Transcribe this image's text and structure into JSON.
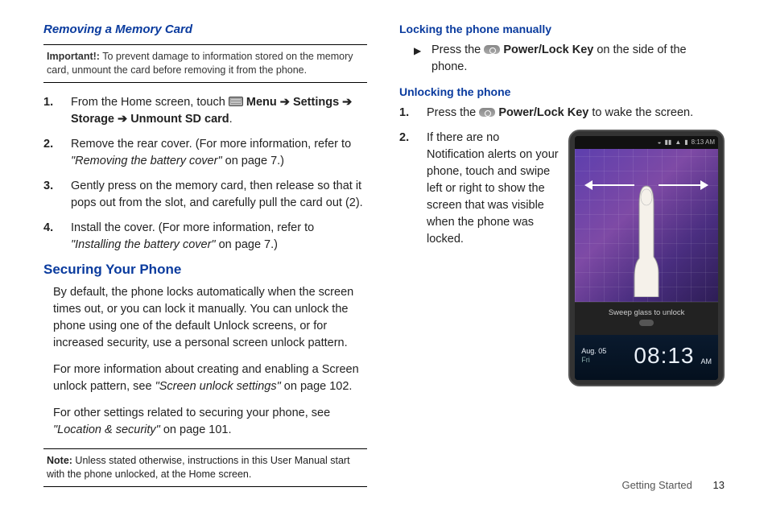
{
  "left": {
    "heading_removing": "Removing a Memory Card",
    "important_label": "Important!:",
    "important_text": " To prevent damage to information stored on the memory card, unmount the card before removing it from the phone.",
    "step1_pre": "From the Home screen, touch ",
    "step1_menu": " Menu ",
    "step1_arrow": "➔",
    "step1_settings": " Settings ",
    "step1_storage": "Storage  ",
    "step1_unmount": " Unmount SD card",
    "step1_period": ".",
    "step2a": "Remove the rear cover. (For more information, refer to ",
    "step2b": "\"Removing the battery cover\"",
    "step2c": " on page 7.)",
    "step3": "Gently press on the memory card, then release so that it pops out from the slot, and carefully pull the card out (2).",
    "step4a": "Install the cover. (For more information, refer to ",
    "step4b": "\"Installing the battery cover\"",
    "step4c": " on page 7.)",
    "heading_securing": "Securing Your Phone",
    "para1": "By default, the phone locks automatically when the screen times out, or you can lock it manually. You can unlock the phone using one of the default Unlock screens, or for increased security, use a personal screen unlock pattern.",
    "para2a": "For more information about creating and enabling a Screen unlock pattern, see ",
    "para2b": "\"Screen unlock settings\"",
    "para2c": " on page 102.",
    "para3a": "For other settings related to securing your phone, see ",
    "para3b": "\"Location & security\"",
    "para3c": " on page 101.",
    "note_label": "Note:",
    "note_text": " Unless stated otherwise, instructions in this User Manual start with the phone unlocked, at the Home screen."
  },
  "right": {
    "heading_locking": "Locking the phone manually",
    "lock_pre": "Press the ",
    "lock_key": " Power/Lock Key",
    "lock_post": " on the side of the phone.",
    "heading_unlocking": "Unlocking the phone",
    "unlk1_pre": "Press the ",
    "unlk1_key": " Power/Lock Key",
    "unlk1_post": " to wake the screen.",
    "unlk2": "If there are no Notification alerts on your phone, touch and swipe left or right to show the screen that was visible when the phone was locked.",
    "phone": {
      "status_time": "8:13 AM",
      "sweep": "Sweep glass to unlock",
      "date": "Aug. 05",
      "day": "Fri",
      "time": "08:13",
      "ampm": "AM"
    }
  },
  "footer": {
    "section": "Getting Started",
    "page": "13"
  }
}
